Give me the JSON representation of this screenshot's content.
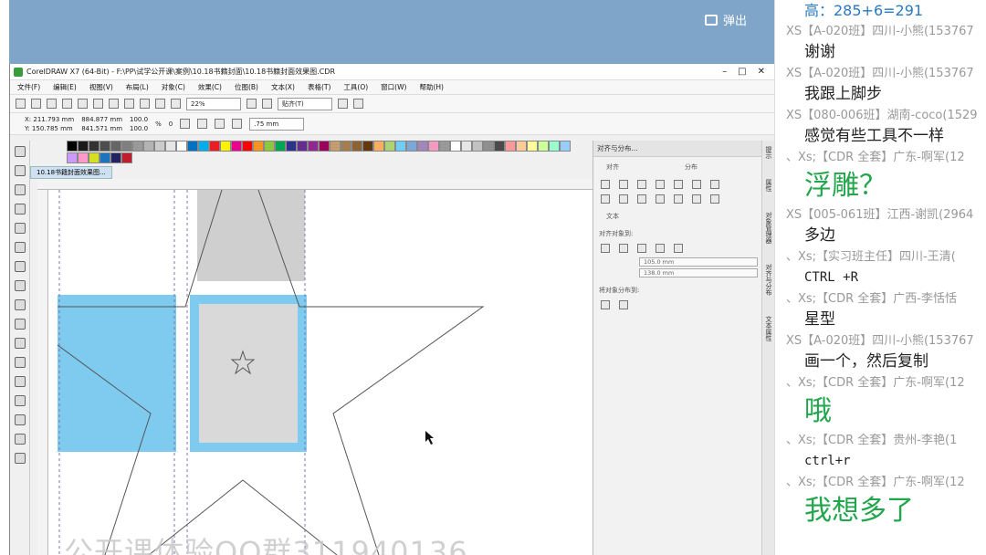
{
  "video_overlay": {
    "popout_label": "弹出",
    "watermark": "公开课体验QQ群311940136"
  },
  "app": {
    "title": "CorelDRAW X7 (64-Bit) - F:\\PP\\试学公开课\\案例\\10.18书籍封面\\10.18书籍封面效果图.CDR",
    "menu": [
      "文件(F)",
      "编辑(E)",
      "视图(V)",
      "布局(L)",
      "对象(C)",
      "效果(C)",
      "位图(B)",
      "文本(X)",
      "表格(T)",
      "工具(O)",
      "窗口(W)",
      "帮助(H)"
    ],
    "zoom": "22%",
    "snap_label": "贴齐(T)",
    "coords": {
      "x": "X: 211.793 mm",
      "y": "Y: 150.785 mm",
      "w": "884.877 mm",
      "h": "841.571 mm",
      "sx": "100.0",
      "sy": "100.0",
      "pct": "%",
      "rotation": "0",
      "outline": ".75 mm"
    },
    "doc_tab": "10.18书籍封面效果图...",
    "docker": {
      "header": "对齐与分布...",
      "align_label": "对齐",
      "distribute_label": "分布",
      "text_label": "文本",
      "align_objects_to": "对齐对象到:",
      "field1": "105.0 mm",
      "field2": "138.0 mm",
      "distribute_to": "将对象分布到:"
    },
    "vtabs": [
      "提示",
      "属性",
      "对象管理器",
      "对齐与分布",
      "文本属性"
    ]
  },
  "palette_colors": [
    "#000000",
    "#1a1a1a",
    "#333333",
    "#4d4d4d",
    "#666666",
    "#808080",
    "#999999",
    "#b3b3b3",
    "#cccccc",
    "#e6e6e6",
    "#ffffff",
    "#0070c0",
    "#00aeef",
    "#ed1c24",
    "#fff200",
    "#ec008c",
    "#ff0000",
    "#f7941d",
    "#8dc63f",
    "#00a651",
    "#2e3192",
    "#662d91",
    "#92278f",
    "#9e005d",
    "#c69c6d",
    "#a67c52",
    "#8c6239",
    "#603913",
    "#fbaf5d",
    "#acd373",
    "#6dcff6",
    "#7da7d9",
    "#a187be",
    "#f49ac1",
    "#999999",
    "#ffffff",
    "#e6e6e6",
    "#c2c2c2",
    "#8f8f8f",
    "#4a4a4a",
    "#ff9999",
    "#ffcc99",
    "#ffff99",
    "#ccff99",
    "#99ffcc",
    "#99ccff",
    "#cc99ff",
    "#ff99cc",
    "#d7df23",
    "#1b75bc",
    "#262262",
    "#be1e2d"
  ],
  "chat": {
    "messages": [
      {
        "header": "",
        "text": "高：285+6=291",
        "style": "blue"
      },
      {
        "header": "XS【A-020班】四川-小熊(153767",
        "text": "谢谢",
        "style": "normal"
      },
      {
        "header": "XS【A-020班】四川-小熊(153767",
        "text": "我跟上脚步",
        "style": "normal"
      },
      {
        "header": "XS【080-006班】湖南-coco(1529",
        "text": "感觉有些工具不一样",
        "style": "normal"
      },
      {
        "header": "、Xs;【CDR 全套】广东-啊军(12",
        "text": "浮雕？",
        "style": "big"
      },
      {
        "header": "XS【005-061班】江西-谢凯(2964",
        "text": "多边",
        "style": "normal"
      },
      {
        "header": "、Xs;【实习班主任】四川-王清(",
        "text": "CTRL +R",
        "style": "mono"
      },
      {
        "header": "、Xs;【CDR 全套】广西-李恬恬",
        "text": "星型",
        "style": "normal"
      },
      {
        "header": "XS【A-020班】四川-小熊(153767",
        "text": "画一个，然后复制",
        "style": "normal"
      },
      {
        "header": "、Xs;【CDR 全套】广东-啊军(12",
        "text": "哦",
        "style": "big"
      },
      {
        "header": "、Xs;【CDR  全套】贵州-李艳(1",
        "text": "ctrl+r",
        "style": "mono"
      },
      {
        "header": "、Xs;【CDR 全套】广东-啊军(12",
        "text": "我想多了",
        "style": "big"
      }
    ]
  }
}
